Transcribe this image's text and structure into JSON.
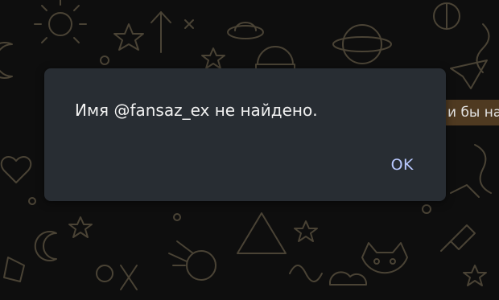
{
  "background_chat": {
    "partial_message": "и бы на"
  },
  "dialog": {
    "message": "Имя @fansaz_ex не найдено.",
    "ok_label": "OK"
  },
  "colors": {
    "dialog_bg": "#282d33",
    "ok_accent": "#b9c9ff",
    "bubble": "#4f3a21"
  }
}
